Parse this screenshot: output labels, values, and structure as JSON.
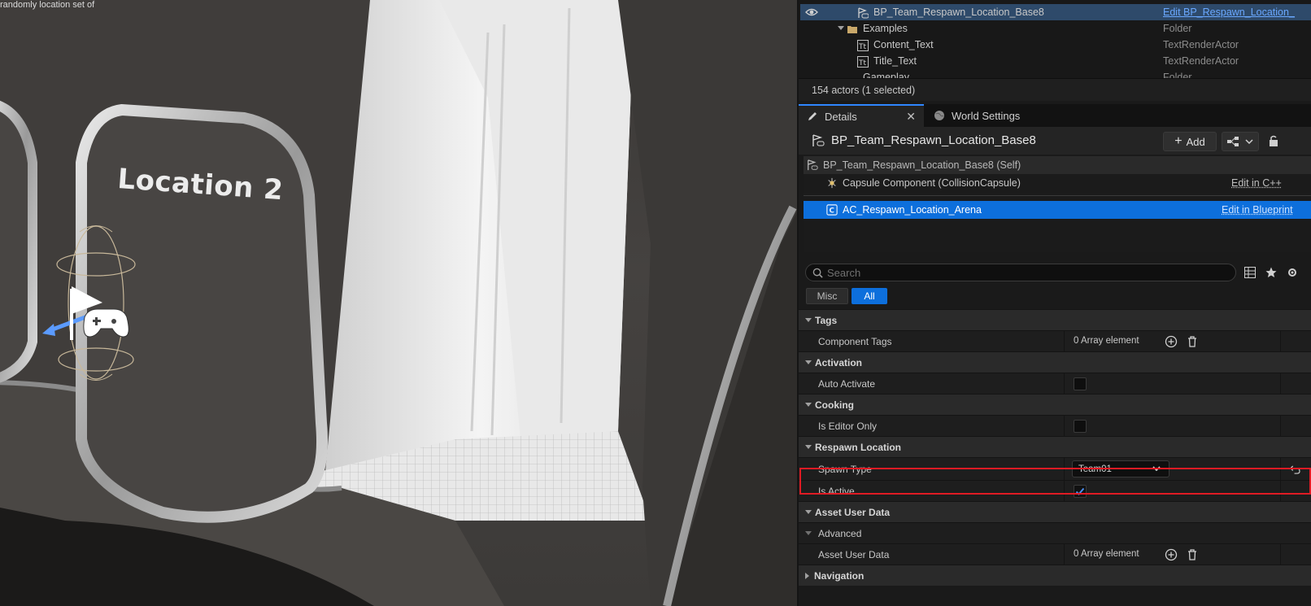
{
  "viewport": {
    "sign_label": "Location 2",
    "top_text_fragment": "randomly location set of"
  },
  "outliner": {
    "rows": [
      {
        "name": "BP_Team_Respawn_Location_Base8",
        "type": "Edit BP_Respawn_Location_",
        "selected": true
      },
      {
        "name": "Examples",
        "type": "Folder"
      },
      {
        "name": "Content_Text",
        "type": "TextRenderActor"
      },
      {
        "name": "Title_Text",
        "type": "TextRenderActor"
      },
      {
        "name": "Gameplay",
        "type": "Folder"
      }
    ],
    "actor_count": "154 actors (1 selected)"
  },
  "tabs": {
    "details": "Details",
    "world_settings": "World Settings"
  },
  "details": {
    "title": "BP_Team_Respawn_Location_Base8",
    "add_label": "Add",
    "components": [
      {
        "name": "BP_Team_Respawn_Location_Base8 (Self)",
        "edit": ""
      },
      {
        "name": "Capsule Component (CollisionCapsule)",
        "edit": "Edit in C++"
      },
      {
        "name": "AC_Respawn_Location_Arena",
        "edit": "Edit in Blueprint"
      }
    ],
    "search_placeholder": "Search",
    "filters": {
      "misc": "Misc",
      "all": "All"
    },
    "sections": {
      "tags": "Tags",
      "activation": "Activation",
      "cooking": "Cooking",
      "respawn": "Respawn Location",
      "asset_user_data": "Asset User Data",
      "advanced": "Advanced",
      "navigation": "Navigation"
    },
    "props": {
      "component_tags": {
        "name": "Component Tags",
        "value": "0 Array element"
      },
      "auto_activate": {
        "name": "Auto Activate"
      },
      "is_editor_only": {
        "name": "Is Editor Only"
      },
      "spawn_type": {
        "name": "Spawn Type",
        "value": "Team01"
      },
      "is_active": {
        "name": "Is Active"
      },
      "asset_user_data": {
        "name": "Asset User Data",
        "value": "0 Array element"
      }
    }
  },
  "colors": {
    "accent": "#0d6fdc",
    "highlight": "#e01b24",
    "check": "#4a8ef0"
  }
}
